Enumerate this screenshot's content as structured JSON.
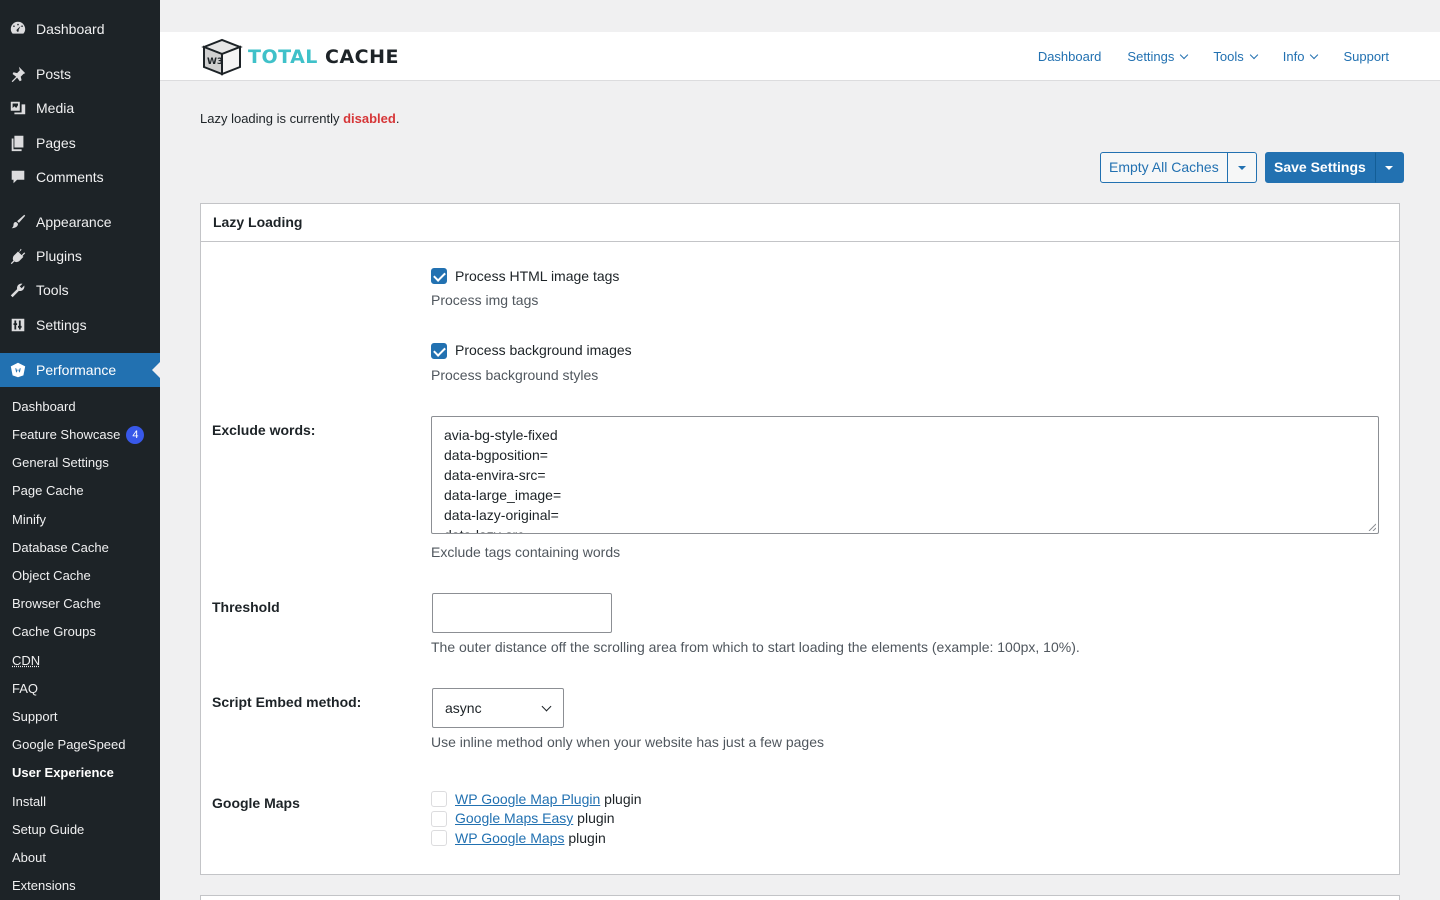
{
  "sidebar": {
    "top_items": [
      {
        "label": "Dashboard",
        "icon": "dashboard-icon"
      },
      {
        "label": "Posts",
        "icon": "pin-icon"
      },
      {
        "label": "Media",
        "icon": "media-icon"
      },
      {
        "label": "Pages",
        "icon": "pages-icon"
      },
      {
        "label": "Comments",
        "icon": "comment-icon"
      },
      {
        "label": "Appearance",
        "icon": "brush-icon"
      },
      {
        "label": "Plugins",
        "icon": "plug-icon"
      },
      {
        "label": "Tools",
        "icon": "wrench-icon"
      },
      {
        "label": "Settings",
        "icon": "sliders-icon"
      },
      {
        "label": "Performance",
        "icon": "performance-icon"
      }
    ],
    "sub_items": [
      {
        "label": "Dashboard"
      },
      {
        "label": "Feature Showcase",
        "badge": "4"
      },
      {
        "label": "General Settings"
      },
      {
        "label": "Page Cache"
      },
      {
        "label": "Minify"
      },
      {
        "label": "Database Cache"
      },
      {
        "label": "Object Cache"
      },
      {
        "label": "Browser Cache"
      },
      {
        "label": "Cache Groups"
      },
      {
        "label": "CDN"
      },
      {
        "label": "FAQ"
      },
      {
        "label": "Support"
      },
      {
        "label": "Google PageSpeed"
      },
      {
        "label": "User Experience"
      },
      {
        "label": "Install"
      },
      {
        "label": "Setup Guide"
      },
      {
        "label": "About"
      },
      {
        "label": "Extensions"
      }
    ]
  },
  "header": {
    "logo": {
      "part1": "TOTAL",
      "part2": " CACHE",
      "cube_text": "W3"
    },
    "nav": [
      {
        "label": "Dashboard"
      },
      {
        "label": "Settings"
      },
      {
        "label": "Tools"
      },
      {
        "label": "Info"
      },
      {
        "label": "Support"
      }
    ]
  },
  "status": {
    "prefix": "Lazy loading is currently ",
    "state": "disabled",
    "suffix": "."
  },
  "buttons": {
    "empty_caches": "Empty All Caches",
    "save_settings": "Save Settings"
  },
  "panel": {
    "title": "Lazy Loading",
    "process_html": {
      "label": "Process HTML image tags",
      "desc": "Process img tags",
      "checked": true
    },
    "process_bg": {
      "label": "Process background images",
      "desc": "Process background styles",
      "checked": true
    },
    "exclude": {
      "label": "Exclude words:",
      "lines": [
        "avia-bg-style-fixed",
        "data-bgposition=",
        "data-envira-src=",
        "data-large_image=",
        "data-lazy-original=",
        "data-lazy-src="
      ],
      "desc": "Exclude tags containing words"
    },
    "threshold": {
      "label": "Threshold",
      "value": "",
      "desc": "The outer distance off the scrolling area from which to start loading the elements (example: 100px, 10%)."
    },
    "embed": {
      "label": "Script Embed method:",
      "value": "async",
      "desc": "Use inline method only when your website has just a few pages"
    },
    "maps": {
      "label": "Google Maps",
      "plugins": [
        {
          "link": "WP Google Map Plugin",
          "suffix": " plugin"
        },
        {
          "link": "Google Maps Easy",
          "suffix": " plugin"
        },
        {
          "link": "WP Google Maps",
          "suffix": " plugin"
        }
      ]
    }
  },
  "colors": {
    "accent": "#2271b1",
    "sidebar_bg": "#1d2327",
    "disabled": "#d63638",
    "badge": "#3858e9"
  }
}
